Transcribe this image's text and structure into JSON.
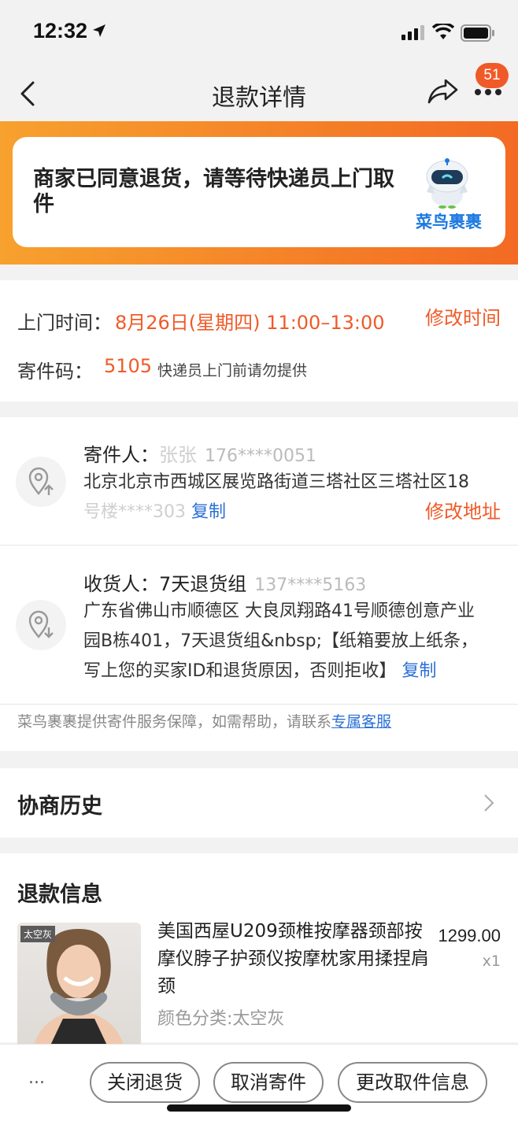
{
  "status": {
    "time": "12:32"
  },
  "nav": {
    "title": "退款详情",
    "badge": "51"
  },
  "banner": {
    "message": "商家已同意退货，请等待快递员上门取件",
    "brand": "菜鸟裹裹"
  },
  "pickup": {
    "time_label": "上门时间：",
    "time_value": "8月26日(星期四) 11:00–13:00",
    "edit_time": "修改时间",
    "code_label": "寄件码：",
    "code_value": "5105",
    "code_hint": "快递员上门前请勿提供"
  },
  "sender": {
    "label": "寄件人：",
    "name": "张张",
    "phone": "176****0051",
    "address_line1": "北京北京市西城区展览路街道三塔社区三塔社区18",
    "address_line2": "号楼****303",
    "copy": "复制",
    "edit_address": "修改地址"
  },
  "receiver": {
    "label": "收货人：",
    "name": "7天退货组",
    "phone": "137****5163",
    "address_line1": "广东省佛山市顺德区 大良凤翔路41号顺德创意产业",
    "address_line2": "园B栋401，7天退货组&nbsp;【纸箱要放上纸条，",
    "address_line3": "写上您的买家ID和退货原因，否则拒收】",
    "copy": "复制"
  },
  "service": {
    "text": "菜鸟裹裹提供寄件服务保障，如需帮助，请联系",
    "link": "专属客服"
  },
  "history": {
    "title": "协商历史"
  },
  "refund": {
    "title": "退款信息",
    "product_tag": "太空灰",
    "product_name": "美国西屋U209颈椎按摩器颈部按摩仪脖子护颈仪按摩枕家用揉捏肩颈",
    "spec": "颜色分类:太空灰",
    "price": "1299.00",
    "qty": "x1"
  },
  "actions": {
    "more": "...",
    "close": "关闭退货",
    "cancel": "取消寄件",
    "change": "更改取件信息"
  },
  "colors": {
    "accent": "#f05a28",
    "link": "#2b6fd6",
    "brand_blue": "#1c78e0"
  }
}
